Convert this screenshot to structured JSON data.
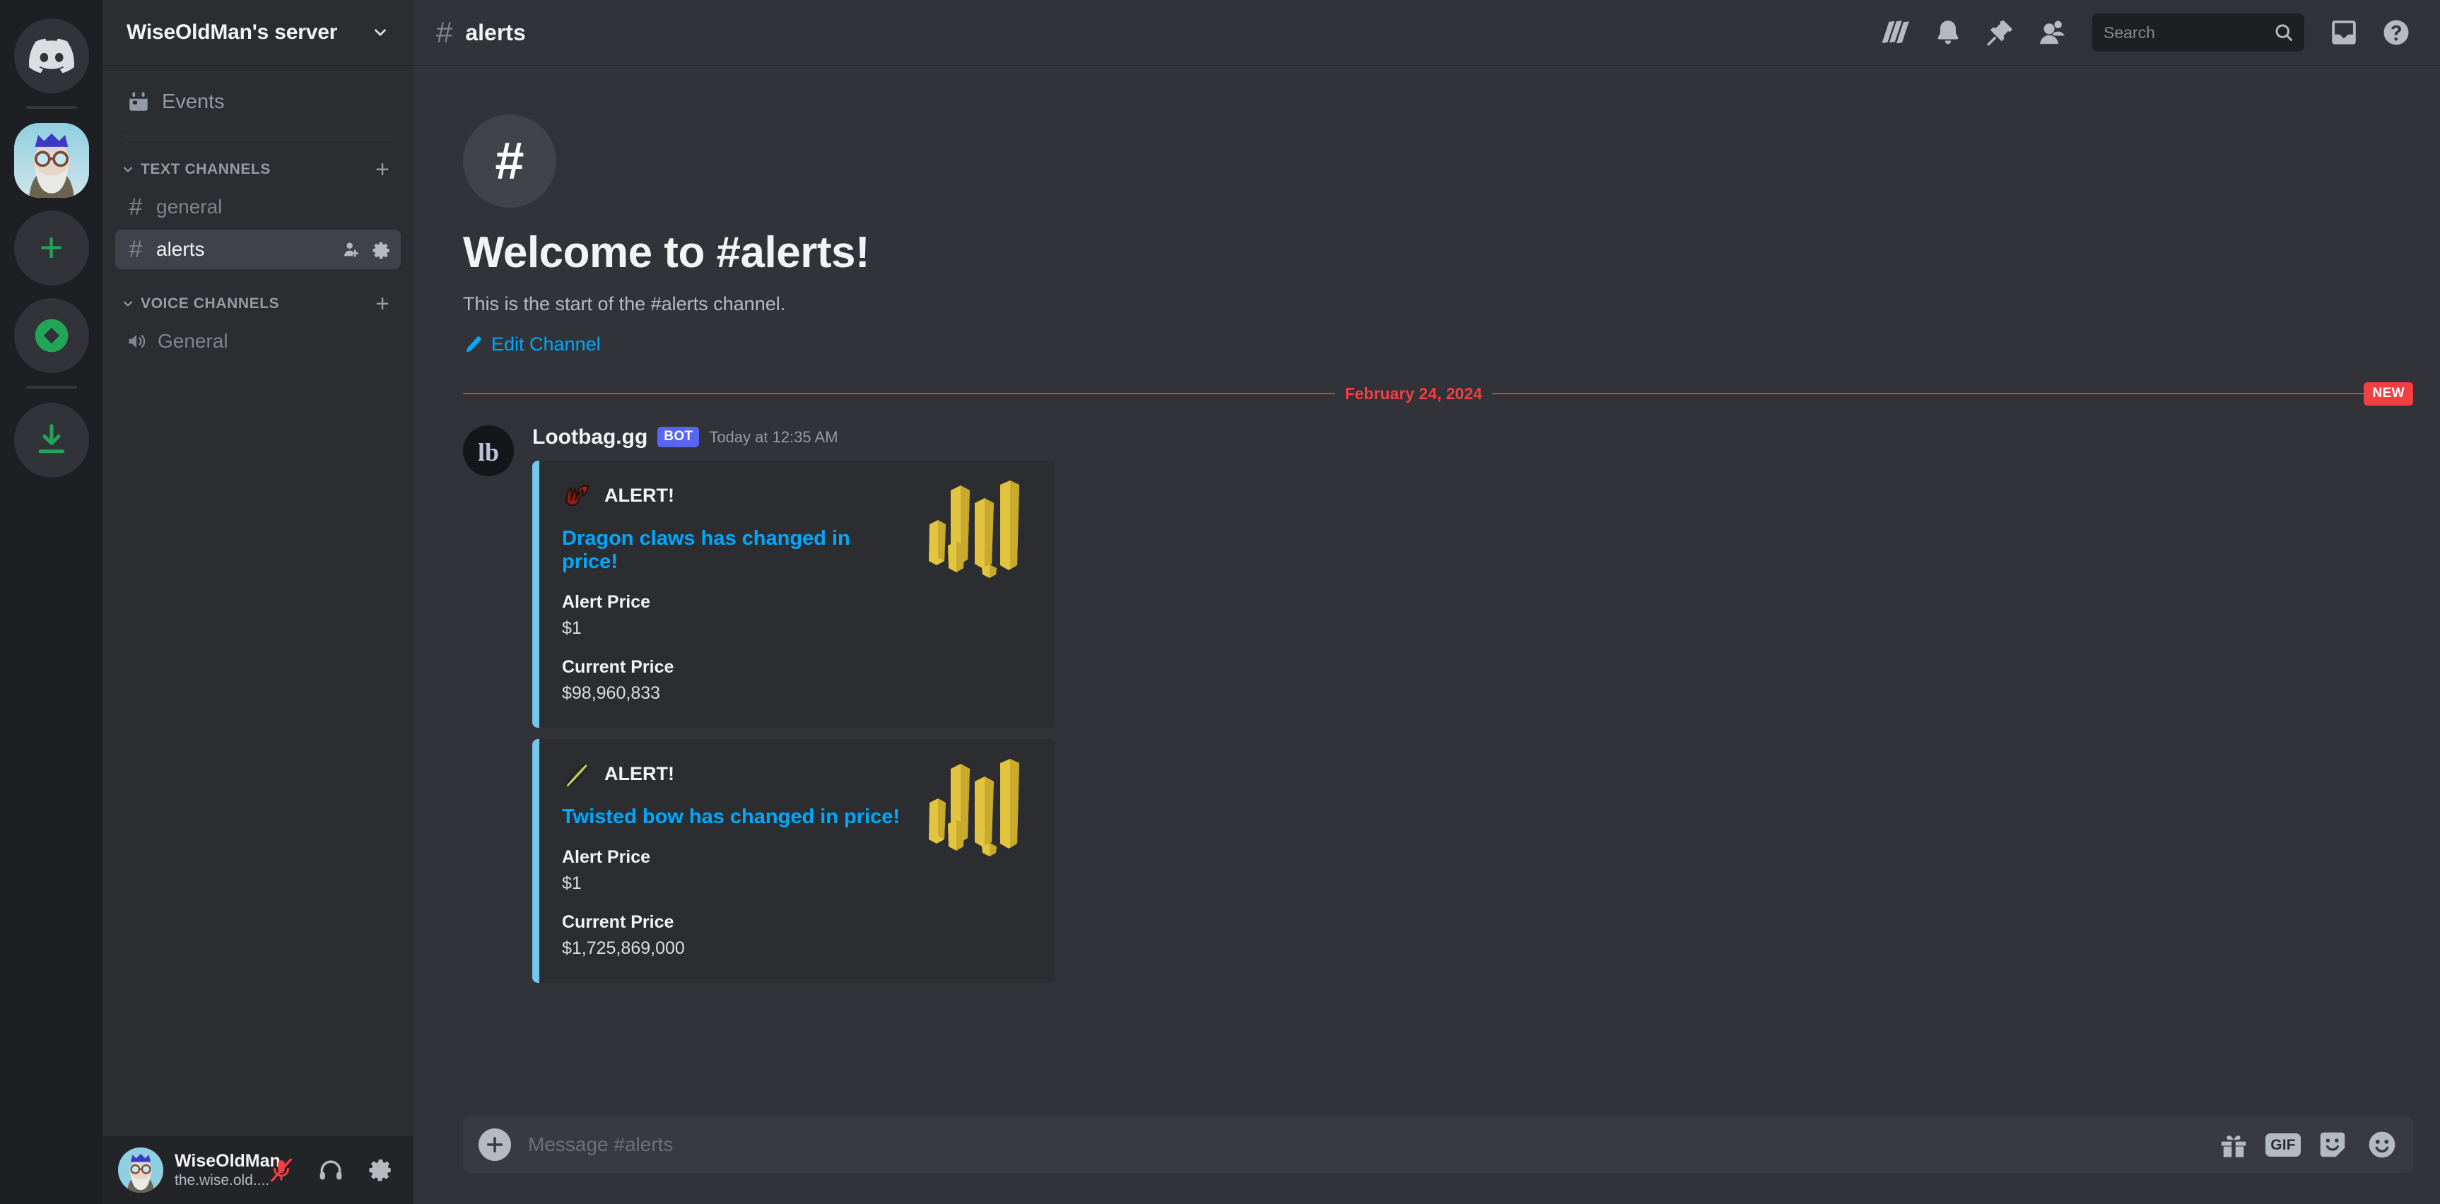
{
  "rail": {
    "items": [
      {
        "name": "discord-home",
        "type": "logo"
      },
      {
        "name": "wiseoldman-server",
        "type": "avatar",
        "active": true
      },
      {
        "name": "add-server",
        "type": "plus",
        "glyph": "+"
      },
      {
        "name": "explore-servers",
        "type": "compass"
      },
      {
        "name": "download-apps",
        "type": "download"
      }
    ]
  },
  "sidebar": {
    "server_name": "WiseOldMan's server",
    "events_label": "Events",
    "categories": [
      {
        "label": "TEXT CHANNELS",
        "channels": [
          {
            "name": "general",
            "selected": false
          },
          {
            "name": "alerts",
            "selected": true
          }
        ]
      },
      {
        "label": "VOICE CHANNELS",
        "channels": [
          {
            "name": "General",
            "selected": false
          }
        ]
      }
    ]
  },
  "user_panel": {
    "username": "WiseOldMan",
    "handle": "the.wise.old....",
    "buttons": [
      {
        "label": "mute-microphone",
        "state": "muted"
      },
      {
        "label": "deafen-headphones",
        "state": "on"
      },
      {
        "label": "user-settings",
        "state": "on"
      }
    ]
  },
  "topbar": {
    "hash": "#",
    "channel_name": "alerts",
    "icons": [
      "threads-icon",
      "notification-bell-icon",
      "pinned-messages-icon",
      "member-list-icon"
    ],
    "search": {
      "placeholder": "Search",
      "value": ""
    },
    "right_icons": [
      "inbox-icon",
      "help-icon"
    ]
  },
  "welcome": {
    "hash": "#",
    "title": "Welcome to #alerts!",
    "subtitle": "This is the start of the #alerts channel.",
    "edit_label": "Edit Channel"
  },
  "divider": {
    "date": "February 24, 2024",
    "new_badge": "NEW",
    "color": "#f23f42"
  },
  "message": {
    "author": "Lootbag.gg",
    "bot_tag": "BOT",
    "timestamp": "Today at 12:35 AM",
    "embed_accent": "#74c7ec",
    "embeds": [
      {
        "emoji": "dragon-claws-icon",
        "alert_label": "ALERT!",
        "title": "Dragon claws has changed in price!",
        "fields": [
          {
            "name": "Alert Price",
            "value": "$1"
          },
          {
            "name": "Current Price",
            "value": "$98,960,833"
          }
        ],
        "thumbnail": "gold-bars-image"
      },
      {
        "emoji": "twisted-bow-icon",
        "alert_label": "ALERT!",
        "title": "Twisted bow has changed in price!",
        "fields": [
          {
            "name": "Alert Price",
            "value": "$1"
          },
          {
            "name": "Current Price",
            "value": "$1,725,869,000"
          }
        ],
        "thumbnail": "gold-bars-image"
      }
    ]
  },
  "composer": {
    "placeholder": "Message #alerts",
    "value": "",
    "actions": [
      "gift-icon",
      "gif-icon",
      "sticker-icon",
      "emoji-icon"
    ],
    "gif_label": "GIF"
  }
}
